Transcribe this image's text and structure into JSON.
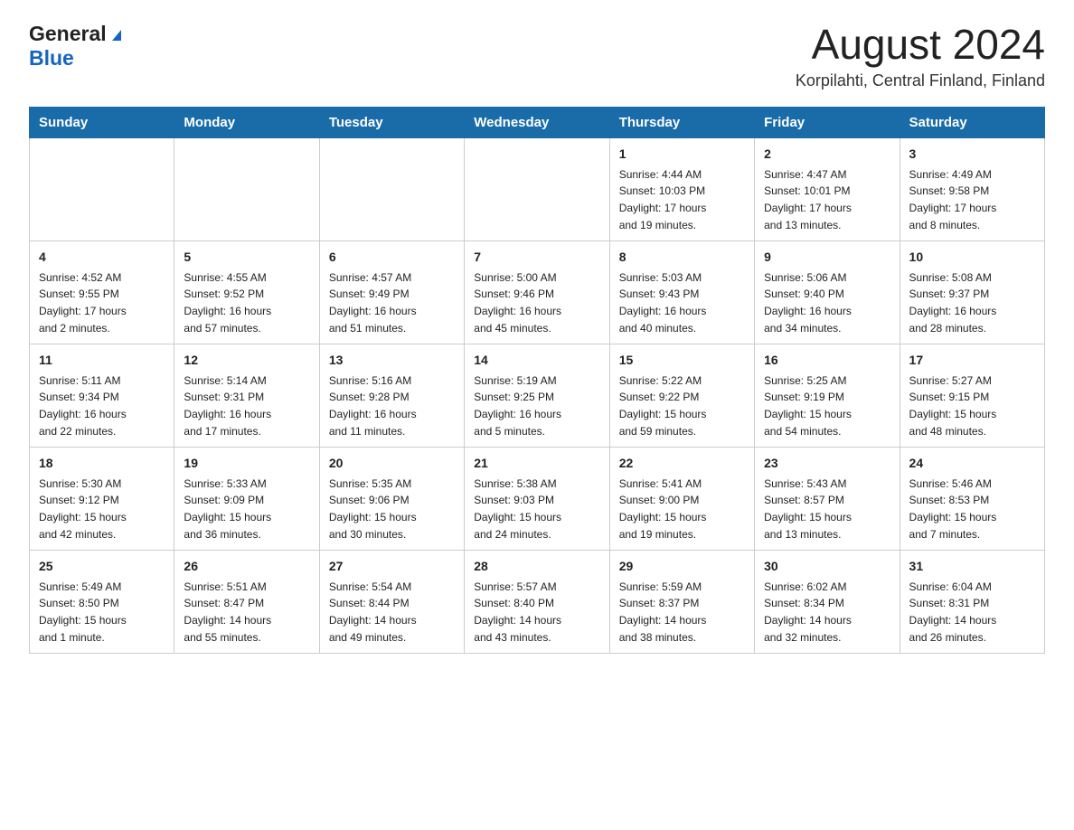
{
  "header": {
    "logo_general": "General",
    "logo_blue": "Blue",
    "month_year": "August 2024",
    "location": "Korpilahti, Central Finland, Finland"
  },
  "weekdays": [
    "Sunday",
    "Monday",
    "Tuesday",
    "Wednesday",
    "Thursday",
    "Friday",
    "Saturday"
  ],
  "weeks": [
    [
      {
        "day": "",
        "info": ""
      },
      {
        "day": "",
        "info": ""
      },
      {
        "day": "",
        "info": ""
      },
      {
        "day": "",
        "info": ""
      },
      {
        "day": "1",
        "info": "Sunrise: 4:44 AM\nSunset: 10:03 PM\nDaylight: 17 hours\nand 19 minutes."
      },
      {
        "day": "2",
        "info": "Sunrise: 4:47 AM\nSunset: 10:01 PM\nDaylight: 17 hours\nand 13 minutes."
      },
      {
        "day": "3",
        "info": "Sunrise: 4:49 AM\nSunset: 9:58 PM\nDaylight: 17 hours\nand 8 minutes."
      }
    ],
    [
      {
        "day": "4",
        "info": "Sunrise: 4:52 AM\nSunset: 9:55 PM\nDaylight: 17 hours\nand 2 minutes."
      },
      {
        "day": "5",
        "info": "Sunrise: 4:55 AM\nSunset: 9:52 PM\nDaylight: 16 hours\nand 57 minutes."
      },
      {
        "day": "6",
        "info": "Sunrise: 4:57 AM\nSunset: 9:49 PM\nDaylight: 16 hours\nand 51 minutes."
      },
      {
        "day": "7",
        "info": "Sunrise: 5:00 AM\nSunset: 9:46 PM\nDaylight: 16 hours\nand 45 minutes."
      },
      {
        "day": "8",
        "info": "Sunrise: 5:03 AM\nSunset: 9:43 PM\nDaylight: 16 hours\nand 40 minutes."
      },
      {
        "day": "9",
        "info": "Sunrise: 5:06 AM\nSunset: 9:40 PM\nDaylight: 16 hours\nand 34 minutes."
      },
      {
        "day": "10",
        "info": "Sunrise: 5:08 AM\nSunset: 9:37 PM\nDaylight: 16 hours\nand 28 minutes."
      }
    ],
    [
      {
        "day": "11",
        "info": "Sunrise: 5:11 AM\nSunset: 9:34 PM\nDaylight: 16 hours\nand 22 minutes."
      },
      {
        "day": "12",
        "info": "Sunrise: 5:14 AM\nSunset: 9:31 PM\nDaylight: 16 hours\nand 17 minutes."
      },
      {
        "day": "13",
        "info": "Sunrise: 5:16 AM\nSunset: 9:28 PM\nDaylight: 16 hours\nand 11 minutes."
      },
      {
        "day": "14",
        "info": "Sunrise: 5:19 AM\nSunset: 9:25 PM\nDaylight: 16 hours\nand 5 minutes."
      },
      {
        "day": "15",
        "info": "Sunrise: 5:22 AM\nSunset: 9:22 PM\nDaylight: 15 hours\nand 59 minutes."
      },
      {
        "day": "16",
        "info": "Sunrise: 5:25 AM\nSunset: 9:19 PM\nDaylight: 15 hours\nand 54 minutes."
      },
      {
        "day": "17",
        "info": "Sunrise: 5:27 AM\nSunset: 9:15 PM\nDaylight: 15 hours\nand 48 minutes."
      }
    ],
    [
      {
        "day": "18",
        "info": "Sunrise: 5:30 AM\nSunset: 9:12 PM\nDaylight: 15 hours\nand 42 minutes."
      },
      {
        "day": "19",
        "info": "Sunrise: 5:33 AM\nSunset: 9:09 PM\nDaylight: 15 hours\nand 36 minutes."
      },
      {
        "day": "20",
        "info": "Sunrise: 5:35 AM\nSunset: 9:06 PM\nDaylight: 15 hours\nand 30 minutes."
      },
      {
        "day": "21",
        "info": "Sunrise: 5:38 AM\nSunset: 9:03 PM\nDaylight: 15 hours\nand 24 minutes."
      },
      {
        "day": "22",
        "info": "Sunrise: 5:41 AM\nSunset: 9:00 PM\nDaylight: 15 hours\nand 19 minutes."
      },
      {
        "day": "23",
        "info": "Sunrise: 5:43 AM\nSunset: 8:57 PM\nDaylight: 15 hours\nand 13 minutes."
      },
      {
        "day": "24",
        "info": "Sunrise: 5:46 AM\nSunset: 8:53 PM\nDaylight: 15 hours\nand 7 minutes."
      }
    ],
    [
      {
        "day": "25",
        "info": "Sunrise: 5:49 AM\nSunset: 8:50 PM\nDaylight: 15 hours\nand 1 minute."
      },
      {
        "day": "26",
        "info": "Sunrise: 5:51 AM\nSunset: 8:47 PM\nDaylight: 14 hours\nand 55 minutes."
      },
      {
        "day": "27",
        "info": "Sunrise: 5:54 AM\nSunset: 8:44 PM\nDaylight: 14 hours\nand 49 minutes."
      },
      {
        "day": "28",
        "info": "Sunrise: 5:57 AM\nSunset: 8:40 PM\nDaylight: 14 hours\nand 43 minutes."
      },
      {
        "day": "29",
        "info": "Sunrise: 5:59 AM\nSunset: 8:37 PM\nDaylight: 14 hours\nand 38 minutes."
      },
      {
        "day": "30",
        "info": "Sunrise: 6:02 AM\nSunset: 8:34 PM\nDaylight: 14 hours\nand 32 minutes."
      },
      {
        "day": "31",
        "info": "Sunrise: 6:04 AM\nSunset: 8:31 PM\nDaylight: 14 hours\nand 26 minutes."
      }
    ]
  ]
}
